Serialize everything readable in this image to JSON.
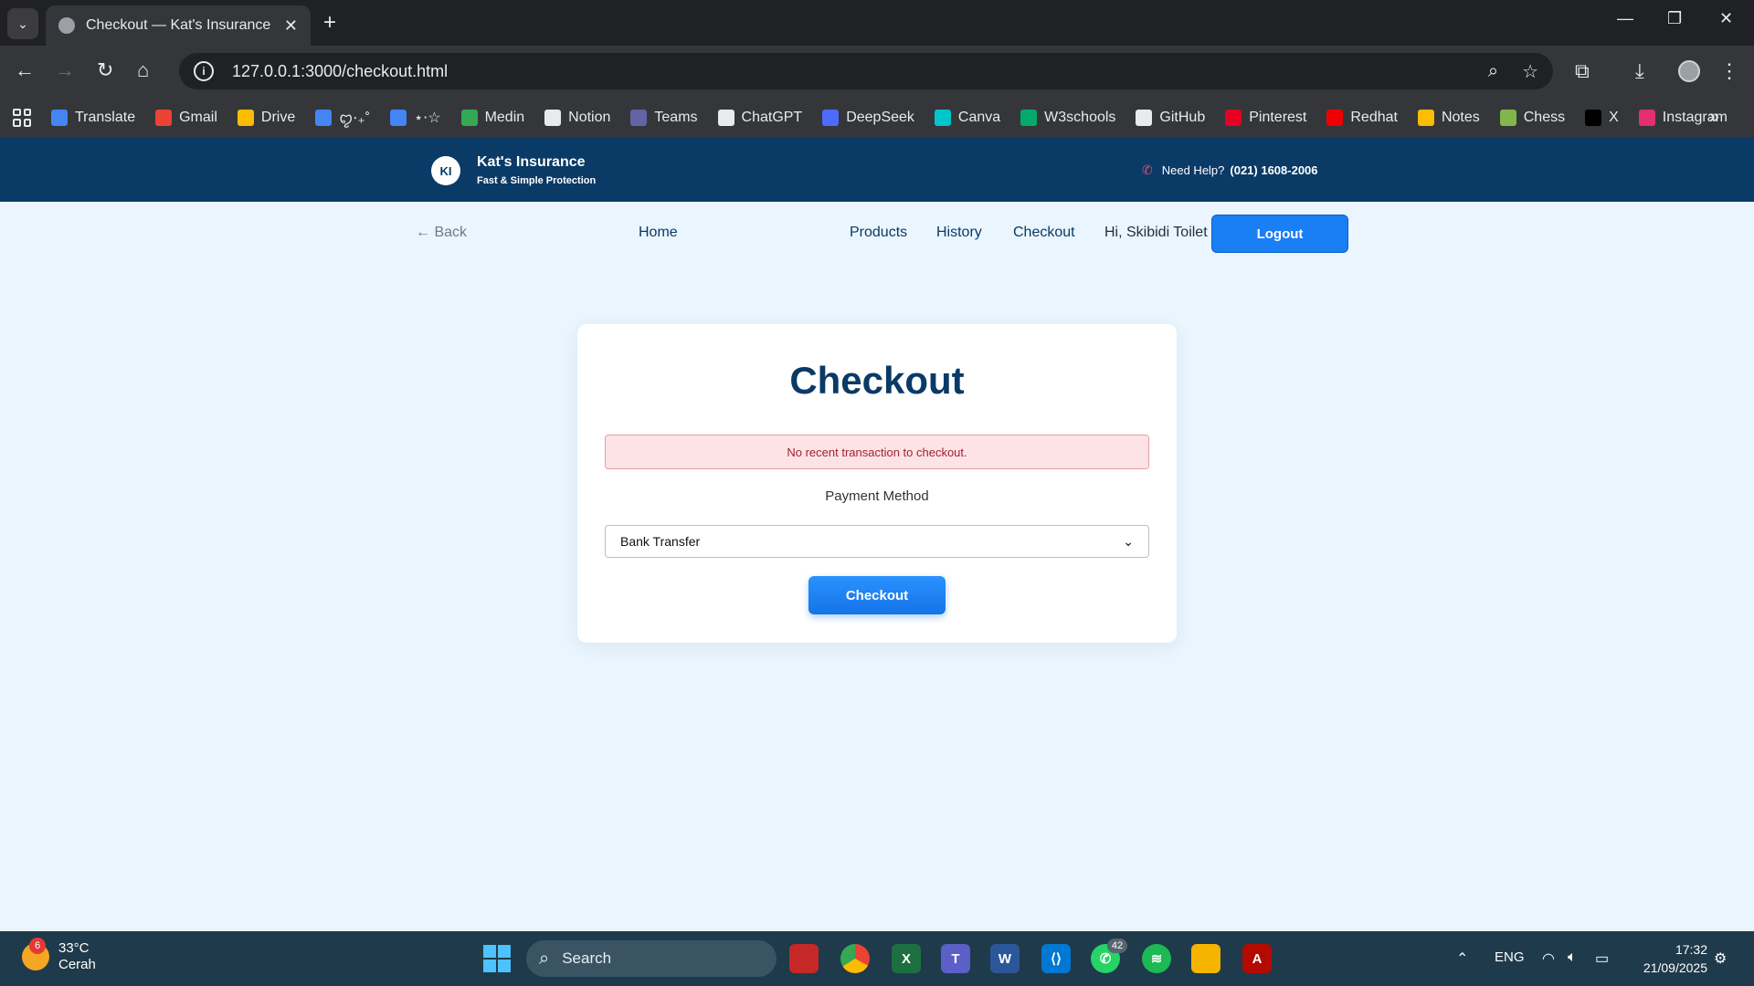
{
  "browser": {
    "tab_title": "Checkout — Kat's Insurance",
    "url": "127.0.0.1:3000/checkout.html",
    "bookmarks": [
      {
        "label": "Translate",
        "color": "#4285f4"
      },
      {
        "label": "Gmail",
        "color": "#ea4335"
      },
      {
        "label": "Drive",
        "color": "#fbbc04"
      },
      {
        "label": "ꨄ︎‧₊˚",
        "color": "#4285f4"
      },
      {
        "label": "⋆⋅☆",
        "color": "#4285f4"
      },
      {
        "label": "Medin",
        "color": "#34a853"
      },
      {
        "label": "Notion",
        "color": "#e8eaed"
      },
      {
        "label": "Teams",
        "color": "#6264a7"
      },
      {
        "label": "ChatGPT",
        "color": "#e8eaed"
      },
      {
        "label": "DeepSeek",
        "color": "#4d6bfe"
      },
      {
        "label": "Canva",
        "color": "#00c4cc"
      },
      {
        "label": "W3schools",
        "color": "#04aa6d"
      },
      {
        "label": "GitHub",
        "color": "#e8eaed"
      },
      {
        "label": "Pinterest",
        "color": "#e60023"
      },
      {
        "label": "Redhat",
        "color": "#ee0000"
      },
      {
        "label": "Notes",
        "color": "#fbbc04"
      },
      {
        "label": "Chess",
        "color": "#81b64c"
      },
      {
        "label": "X",
        "color": "#000000"
      },
      {
        "label": "Instagram",
        "color": "#e1306c"
      }
    ]
  },
  "site": {
    "logo_initials": "KI",
    "name": "Kat's Insurance",
    "tagline": "Fast & Simple Protection",
    "help_label": "Need Help?",
    "help_phone": "(021) 1608-2006",
    "nav": {
      "back": "← Back",
      "home": "Home",
      "products": "Products",
      "history": "History",
      "checkout": "Checkout",
      "greeting": "Hi, Skibidi Toilet",
      "logout": "Logout"
    },
    "colors": {
      "header": "#0a3a66",
      "accent": "#1a7ef5",
      "page_bg": "#eaf5fd"
    }
  },
  "checkout": {
    "title": "Checkout",
    "alert": "No recent transaction to checkout.",
    "payment_label": "Payment Method",
    "payment_selected": "Bank Transfer",
    "submit": "Checkout"
  },
  "taskbar": {
    "weather_temp": "33°C",
    "weather_desc": "Cerah",
    "weather_badge": "6",
    "search_placeholder": "Search",
    "whatsapp_badge": "42",
    "language": "ENG",
    "time": "17:32",
    "date": "21/09/2025"
  }
}
